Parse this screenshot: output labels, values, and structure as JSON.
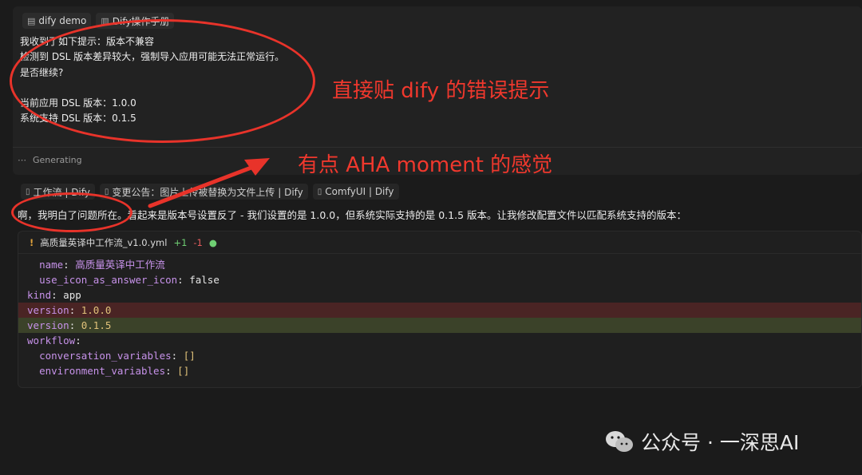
{
  "context_tabs": [
    {
      "icon": "file-icon",
      "label": "dify demo"
    },
    {
      "icon": "book-icon",
      "label": "Dify操作手册"
    }
  ],
  "user_message": {
    "lines": [
      "我收到了如下提示：版本不兼容",
      "检测到 DSL 版本差异较大，强制导入应用可能无法正常运行。",
      "是否继续?",
      "",
      "当前应用 DSL 版本：1.0.0",
      "系统支持 DSL 版本：0.1.5"
    ]
  },
  "status": {
    "generating": "Generating"
  },
  "reference_tabs": [
    {
      "icon": "doc-icon",
      "label": "工作流 | Dify"
    },
    {
      "icon": "doc-icon",
      "label": "变更公告：图片上传被替换为文件上传 | Dify"
    },
    {
      "icon": "doc-icon",
      "label": "ComfyUI | Dify"
    }
  ],
  "answer": {
    "text": "啊，我明白了问题所在。看起来是版本号设置反了 - 我们设置的是 1.0.0，但系统实际支持的是 0.1.5 版本。让我修改配置文件以匹配系统支持的版本："
  },
  "code_block": {
    "filename": "高质量英译中工作流_v1.0.yml",
    "additions": "+1",
    "deletions": "-1",
    "lines": [
      {
        "type": "ctx",
        "indent": "  ",
        "key": "name",
        "value": "高质量英译中工作流"
      },
      {
        "type": "ctx",
        "indent": "  ",
        "key": "use_icon_as_answer_icon",
        "value": "false"
      },
      {
        "type": "ctx",
        "indent": "",
        "key": "kind",
        "value": "app"
      },
      {
        "type": "del",
        "indent": "",
        "key": "version",
        "value": "1.0.0"
      },
      {
        "type": "add",
        "indent": "",
        "key": "version",
        "value": "0.1.5"
      },
      {
        "type": "ctx",
        "indent": "",
        "key": "workflow",
        "value": ""
      },
      {
        "type": "ctx",
        "indent": "  ",
        "key": "conversation_variables",
        "value": "[]"
      },
      {
        "type": "ctx",
        "indent": "  ",
        "key": "environment_variables",
        "value": "[]"
      }
    ]
  },
  "annotations": {
    "note_1": "直接贴 dify 的错误提示",
    "note_2": "有点 AHA moment 的感觉",
    "color": "#e8332a"
  },
  "watermark": {
    "text": "公众号 · 一深思AI"
  }
}
